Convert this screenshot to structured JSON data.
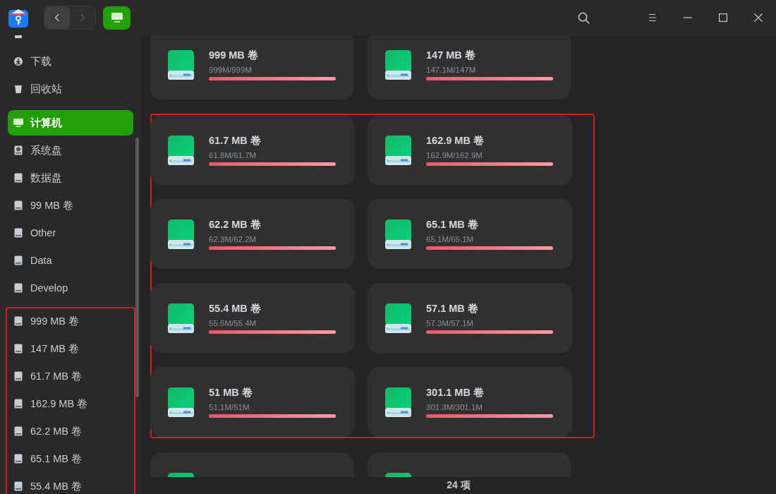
{
  "window": {
    "nav": {
      "back_disabled": false,
      "forward_disabled": true
    }
  },
  "sidebar": {
    "groups": [
      {
        "highlighted": false,
        "items": [
          {
            "kind": "document",
            "selected": false
          },
          {
            "label": "下载",
            "kind": "download",
            "selected": false
          },
          {
            "label": "回收站",
            "kind": "trash",
            "selected": false
          }
        ]
      },
      {
        "highlighted": false,
        "items": [
          {
            "label": "计算机",
            "kind": "computer",
            "selected": true
          },
          {
            "label": "系统盘",
            "kind": "system",
            "selected": false
          },
          {
            "label": "数据盘",
            "kind": "disk",
            "selected": false
          },
          {
            "label": "99 MB 卷",
            "kind": "disk",
            "selected": false
          },
          {
            "label": "Other",
            "kind": "disk",
            "selected": false
          },
          {
            "label": "Data",
            "kind": "disk",
            "selected": false
          },
          {
            "label": "Develop",
            "kind": "disk",
            "selected": false
          }
        ]
      },
      {
        "highlighted": true,
        "items": [
          {
            "label": "999 MB 卷",
            "kind": "disk",
            "selected": false
          },
          {
            "label": "147 MB 卷",
            "kind": "disk",
            "selected": false
          },
          {
            "label": "61.7 MB 卷",
            "kind": "disk",
            "selected": false
          },
          {
            "label": "162.9 MB 卷",
            "kind": "disk",
            "selected": false
          },
          {
            "label": "62.2 MB 卷",
            "kind": "disk",
            "selected": false
          },
          {
            "label": "65.1 MB 卷",
            "kind": "disk",
            "selected": false
          },
          {
            "label": "55.4 MB 卷",
            "kind": "disk",
            "selected": false
          }
        ]
      }
    ]
  },
  "main": {
    "groups": [
      {
        "highlighted": false,
        "cards": [
          {
            "kind": "full",
            "title": "999 MB 卷",
            "usage": "999M/999M",
            "level": 1
          },
          {
            "kind": "full",
            "title": "147 MB 卷",
            "usage": "147.1M/147M",
            "level": 1
          }
        ]
      },
      {
        "highlighted": true,
        "cards": [
          {
            "kind": "full",
            "title": "61.7 MB 卷",
            "usage": "61.8M/61.7M",
            "level": 1
          },
          {
            "kind": "full",
            "title": "162.9 MB 卷",
            "usage": "162.9M/162.9M",
            "level": 1
          },
          {
            "kind": "full",
            "title": "62.2 MB 卷",
            "usage": "62.3M/62.2M",
            "level": 1
          },
          {
            "kind": "full",
            "title": "65.1 MB 卷",
            "usage": "65.1M/65.1M",
            "level": 1
          },
          {
            "kind": "full",
            "title": "55.4 MB 卷",
            "usage": "55.5M/55.4M",
            "level": 1
          },
          {
            "kind": "full",
            "title": "57.1 MB 卷",
            "usage": "57.3M/57.1M",
            "level": 1
          },
          {
            "kind": "full",
            "title": "51 MB 卷",
            "usage": "51.1M/51M",
            "level": 1
          },
          {
            "kind": "full",
            "title": "301.1 MB 卷",
            "usage": "301.3M/301.1M",
            "level": 1
          }
        ]
      },
      {
        "highlighted": false,
        "cards": [
          {
            "kind": "cut"
          },
          {
            "kind": "cut"
          }
        ]
      }
    ]
  },
  "status_bar": {
    "count": "24 项"
  }
}
